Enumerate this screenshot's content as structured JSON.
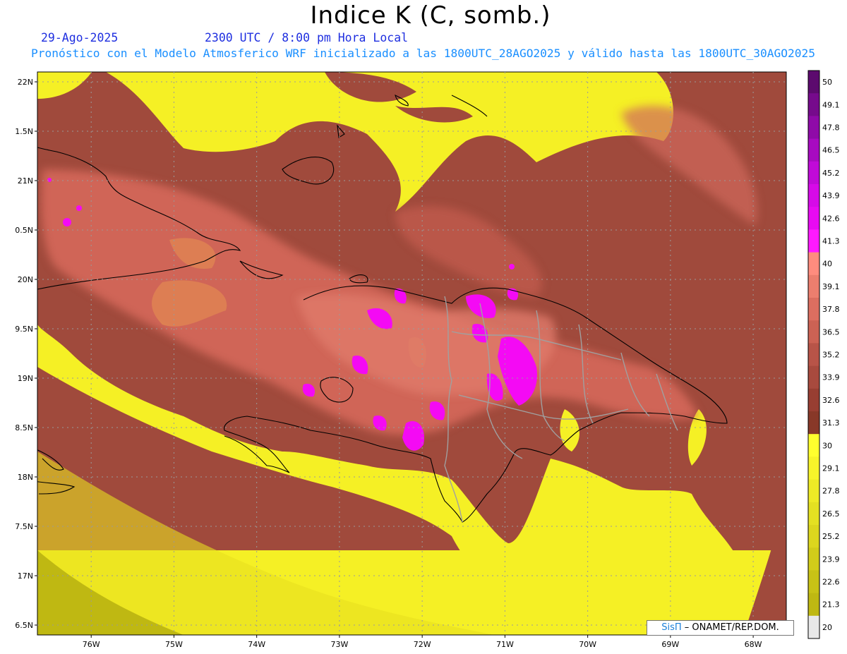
{
  "header": {
    "title": "Indice K (C, somb.)",
    "date": "29-Ago-2025",
    "time": "2300 UTC / 8:00 pm Hora Local",
    "model_line": "Pronóstico con el Modelo Atmosferico WRF inicializado a las 1800UTC_28AGO2025 y válido hasta las  1800UTC_30AGO2025"
  },
  "axes": {
    "lat_labels": [
      "22N",
      "1.5N",
      "21N",
      "0.5N",
      "20N",
      "9.5N",
      "19N",
      "8.5N",
      "18N",
      "7.5N",
      "17N",
      "6.5N"
    ],
    "lat_values": [
      22,
      21.5,
      21,
      20.5,
      20,
      19.5,
      19,
      18.5,
      18,
      17.5,
      17,
      16.5
    ],
    "lon_labels": [
      "76W",
      "75W",
      "74W",
      "73W",
      "72W",
      "71W",
      "70W",
      "69W",
      "68W"
    ],
    "lon_values": [
      -76,
      -75,
      -74,
      -73,
      -72,
      -71,
      -70,
      -69,
      -68
    ],
    "lon_range": [
      -76.65,
      -67.6
    ],
    "lat_range": [
      16.4,
      22.1
    ],
    "grid": "dotted"
  },
  "colorbar": {
    "labels": [
      "50",
      "49.1",
      "47.8",
      "46.5",
      "45.2",
      "43.9",
      "42.6",
      "41.3",
      "40",
      "39.1",
      "37.8",
      "36.5",
      "35.2",
      "33.9",
      "32.6",
      "31.3",
      "30",
      "29.1",
      "27.8",
      "26.5",
      "25.2",
      "23.9",
      "22.6",
      "21.3",
      "20"
    ],
    "colors": [
      "#5c0a6e",
      "#760a8c",
      "#8f0aa8",
      "#a70ac0",
      "#c00ad8",
      "#d60ae8",
      "#e80af2",
      "#ff1aff",
      "#ff8c7e",
      "#ec7e6e",
      "#dc6e60",
      "#cc6254",
      "#b85448",
      "#a84a3e",
      "#983e32",
      "#883828",
      "#ffff2e",
      "#f7f42a",
      "#eeea26",
      "#e4e022",
      "#dcd61e",
      "#d2cc1a",
      "#c8c216",
      "#bfb812",
      "#e8e8e8"
    ]
  },
  "credit": {
    "brand": "SisΠ",
    "org": " – ONAMET/REP.DOM."
  }
}
